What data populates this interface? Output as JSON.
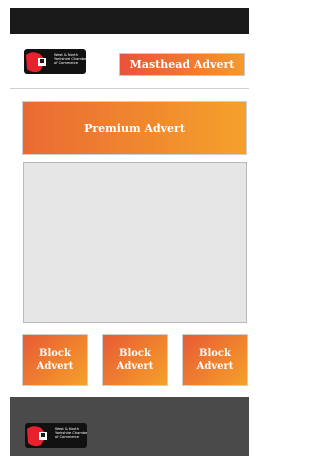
{
  "logo": {
    "line1": "West & North",
    "line2": "Yorkshire Chamber",
    "line3": "of Commerce"
  },
  "masthead": {
    "label": "Masthead Advert"
  },
  "premium": {
    "label": "Premium Advert"
  },
  "blocks": [
    {
      "line1": "Block",
      "line2": "Advert"
    },
    {
      "line1": "Block",
      "line2": "Advert"
    },
    {
      "line1": "Block",
      "line2": "Advert"
    }
  ],
  "footer_logo": {
    "line1": "West & North",
    "line2": "Yorkshire Chamber",
    "line3": "of Commerce"
  },
  "colors": {
    "topbar": "#1a1a1a",
    "accent_start": "#e8523a",
    "accent_end": "#f5a12b",
    "footer": "#4a4a4a",
    "content_box": "#e6e6e6"
  }
}
